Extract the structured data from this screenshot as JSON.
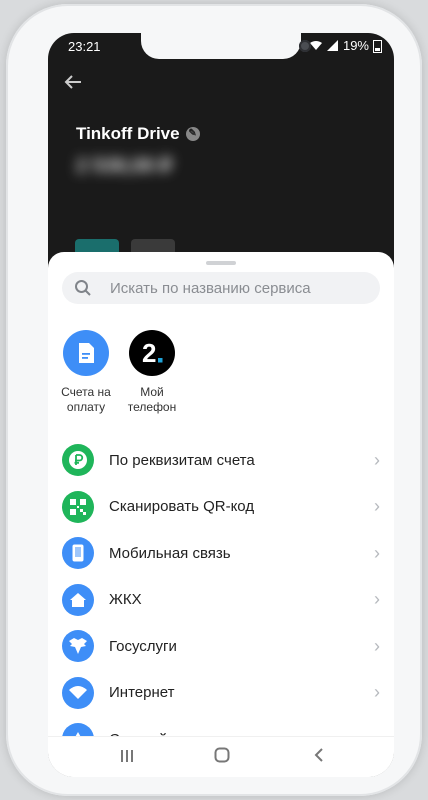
{
  "status": {
    "time": "23:21",
    "battery": "19%"
  },
  "card": {
    "title": "Tinkoff Drive",
    "balance": "2 538,08 ₽"
  },
  "search": {
    "placeholder": "Искать по названию сервиса"
  },
  "quick_actions": [
    {
      "label_line1": "Счета на",
      "label_line2": "оплату",
      "icon": "document-icon"
    },
    {
      "label_line1": "Мой",
      "label_line2": "телефон",
      "icon": "tele2-logo"
    }
  ],
  "services": [
    {
      "label": "По реквизитам счета",
      "icon": "ruble-icon",
      "color": "#1fb55a"
    },
    {
      "label": "Сканировать QR-код",
      "icon": "qr-icon",
      "color": "#1fb55a"
    },
    {
      "label": "Мобильная связь",
      "icon": "mobile-icon",
      "color": "#3e8ef7"
    },
    {
      "label": "ЖКХ",
      "icon": "house-icon",
      "color": "#3e8ef7"
    },
    {
      "label": "Госуслуги",
      "icon": "eagle-icon",
      "color": "#3e8ef7"
    },
    {
      "label": "Интернет",
      "icon": "wifi-icon",
      "color": "#3e8ef7"
    },
    {
      "label": "Сетевой маркетинг",
      "icon": "network-icon",
      "color": "#3e8ef7"
    }
  ],
  "colors": {
    "accent_blue": "#3e8ef7",
    "accent_green": "#1fb55a"
  }
}
